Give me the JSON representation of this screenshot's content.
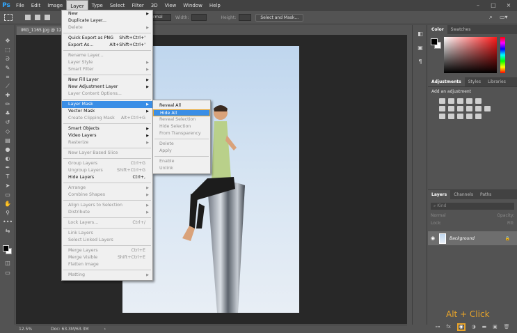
{
  "app": {
    "logo": "Ps"
  },
  "menubar": {
    "items": [
      "File",
      "Edit",
      "Image",
      "Layer",
      "Type",
      "Select",
      "Filter",
      "3D",
      "View",
      "Window",
      "Help"
    ],
    "active": "Layer",
    "window_controls": [
      "–",
      "□",
      "×"
    ]
  },
  "options_bar": {
    "style_value": "Normal",
    "width_label": "Width:",
    "height_label": "Height:",
    "select_mask_label": "Select and Mask..."
  },
  "document": {
    "tab_title": "IMG_1165.jpg @ 12.5",
    "zoom": "12.5%",
    "doc_size": "Doc: 63.3M/63.3M"
  },
  "layer_menu": {
    "items": [
      {
        "label": "New",
        "arrow": true
      },
      {
        "label": "Duplicate Layer..."
      },
      {
        "label": "Delete",
        "arrow": true,
        "disabled": true
      },
      {
        "sep": true
      },
      {
        "label": "Quick Export as PNG",
        "shortcut": "Shift+Ctrl+'"
      },
      {
        "label": "Export As...",
        "shortcut": "Alt+Shift+Ctrl+'"
      },
      {
        "sep": true
      },
      {
        "label": "Rename Layer...",
        "disabled": true
      },
      {
        "label": "Layer Style",
        "arrow": true,
        "disabled": true
      },
      {
        "label": "Smart Filter",
        "arrow": true,
        "disabled": true
      },
      {
        "sep": true
      },
      {
        "label": "New Fill Layer",
        "arrow": true
      },
      {
        "label": "New Adjustment Layer",
        "arrow": true
      },
      {
        "label": "Layer Content Options...",
        "disabled": true
      },
      {
        "sep": true
      },
      {
        "label": "Layer Mask",
        "arrow": true,
        "highlight": true
      },
      {
        "label": "Vector Mask",
        "arrow": true
      },
      {
        "label": "Create Clipping Mask",
        "shortcut": "Alt+Ctrl+G",
        "disabled": true
      },
      {
        "sep": true
      },
      {
        "label": "Smart Objects",
        "arrow": true
      },
      {
        "label": "Video Layers",
        "arrow": true
      },
      {
        "label": "Rasterize",
        "arrow": true,
        "disabled": true
      },
      {
        "sep": true
      },
      {
        "label": "New Layer Based Slice",
        "disabled": true
      },
      {
        "sep": true
      },
      {
        "label": "Group Layers",
        "shortcut": "Ctrl+G",
        "disabled": true
      },
      {
        "label": "Ungroup Layers",
        "shortcut": "Shift+Ctrl+G",
        "disabled": true
      },
      {
        "label": "Hide Layers",
        "shortcut": "Ctrl+,"
      },
      {
        "sep": true
      },
      {
        "label": "Arrange",
        "arrow": true,
        "disabled": true
      },
      {
        "label": "Combine Shapes",
        "arrow": true,
        "disabled": true
      },
      {
        "sep": true
      },
      {
        "label": "Align Layers to Selection",
        "arrow": true,
        "disabled": true
      },
      {
        "label": "Distribute",
        "arrow": true,
        "disabled": true
      },
      {
        "sep": true
      },
      {
        "label": "Lock Layers...",
        "shortcut": "Ctrl+/",
        "disabled": true
      },
      {
        "sep": true
      },
      {
        "label": "Link Layers",
        "disabled": true
      },
      {
        "label": "Select Linked Layers",
        "disabled": true
      },
      {
        "sep": true
      },
      {
        "label": "Merge Layers",
        "shortcut": "Ctrl+E",
        "disabled": true
      },
      {
        "label": "Merge Visible",
        "shortcut": "Shift+Ctrl+E",
        "disabled": true
      },
      {
        "label": "Flatten Image",
        "disabled": true
      },
      {
        "sep": true
      },
      {
        "label": "Matting",
        "arrow": true,
        "disabled": true
      }
    ]
  },
  "layer_mask_submenu": {
    "items": [
      {
        "label": "Reveal All"
      },
      {
        "label": "Hide All",
        "highlight": true
      },
      {
        "label": "Reveal Selection",
        "disabled": true
      },
      {
        "label": "Hide Selection",
        "disabled": true
      },
      {
        "label": "From Transparency",
        "disabled": true
      },
      {
        "sep": true
      },
      {
        "label": "Delete",
        "disabled": true
      },
      {
        "label": "Apply",
        "disabled": true
      },
      {
        "sep": true
      },
      {
        "label": "Enable",
        "disabled": true
      },
      {
        "label": "Unlink",
        "disabled": true
      }
    ]
  },
  "color_panel": {
    "tabs": [
      "Color",
      "Swatches"
    ]
  },
  "adjustments_panel": {
    "tabs": [
      "Adjustments",
      "Styles",
      "Libraries"
    ],
    "title": "Add an adjustment"
  },
  "layers_panel": {
    "tabs": [
      "Layers",
      "Channels",
      "Paths"
    ],
    "filter_placeholder": "Kind",
    "blend_mode": "Normal",
    "opacity_label": "Opacity:",
    "lock_label": "Lock:",
    "fill_label": "Fill:",
    "layer_name": "Background"
  },
  "annotation": {
    "text": "Alt + Click",
    "color": "#e8a42a"
  }
}
